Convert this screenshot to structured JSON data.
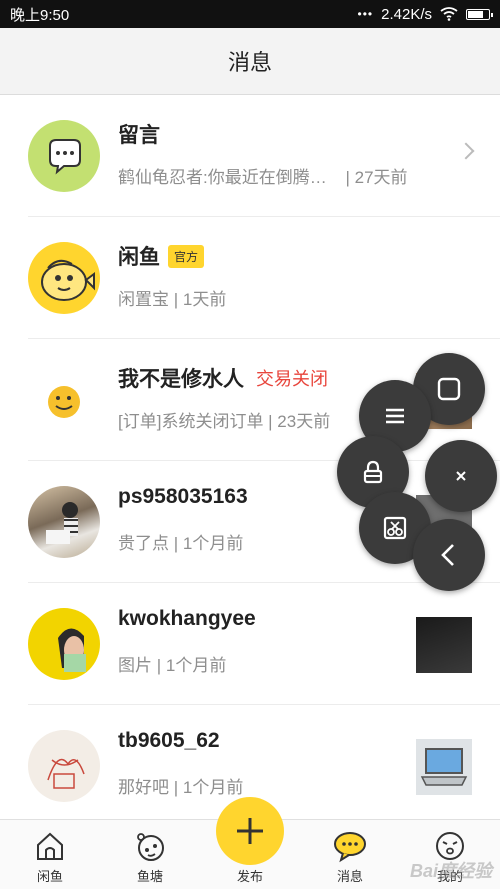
{
  "status_bar": {
    "time": "晚上9:50",
    "net_speed": "2.42K/s"
  },
  "header": {
    "title": "消息"
  },
  "messages": [
    {
      "name": "留言",
      "preview": "鹤仙龟忍者:你最近在倒腾…",
      "time": "| 27天前"
    },
    {
      "name": "闲鱼",
      "badge": "官方",
      "preview": "闲置宝 | 1天前"
    },
    {
      "name": "我不是修水人",
      "status": "交易关闭",
      "preview": "[订单]系统关闭订单 | 23天前"
    },
    {
      "name": "ps958035163",
      "preview": "贵了点 | 1个月前"
    },
    {
      "name": "kwokhangyee",
      "preview": "图片 | 1个月前"
    },
    {
      "name": "tb9605_62",
      "preview": "那好吧 | 1个月前"
    }
  ],
  "tabs": {
    "xianyu": "闲鱼",
    "yutang": "鱼塘",
    "publish": "发布",
    "messages": "消息",
    "mine": "我的"
  },
  "watermark": "Bai度经验",
  "colors": {
    "accent": "#ffd52e",
    "closed": "#e8453c",
    "floating": "#3b3b3b"
  }
}
